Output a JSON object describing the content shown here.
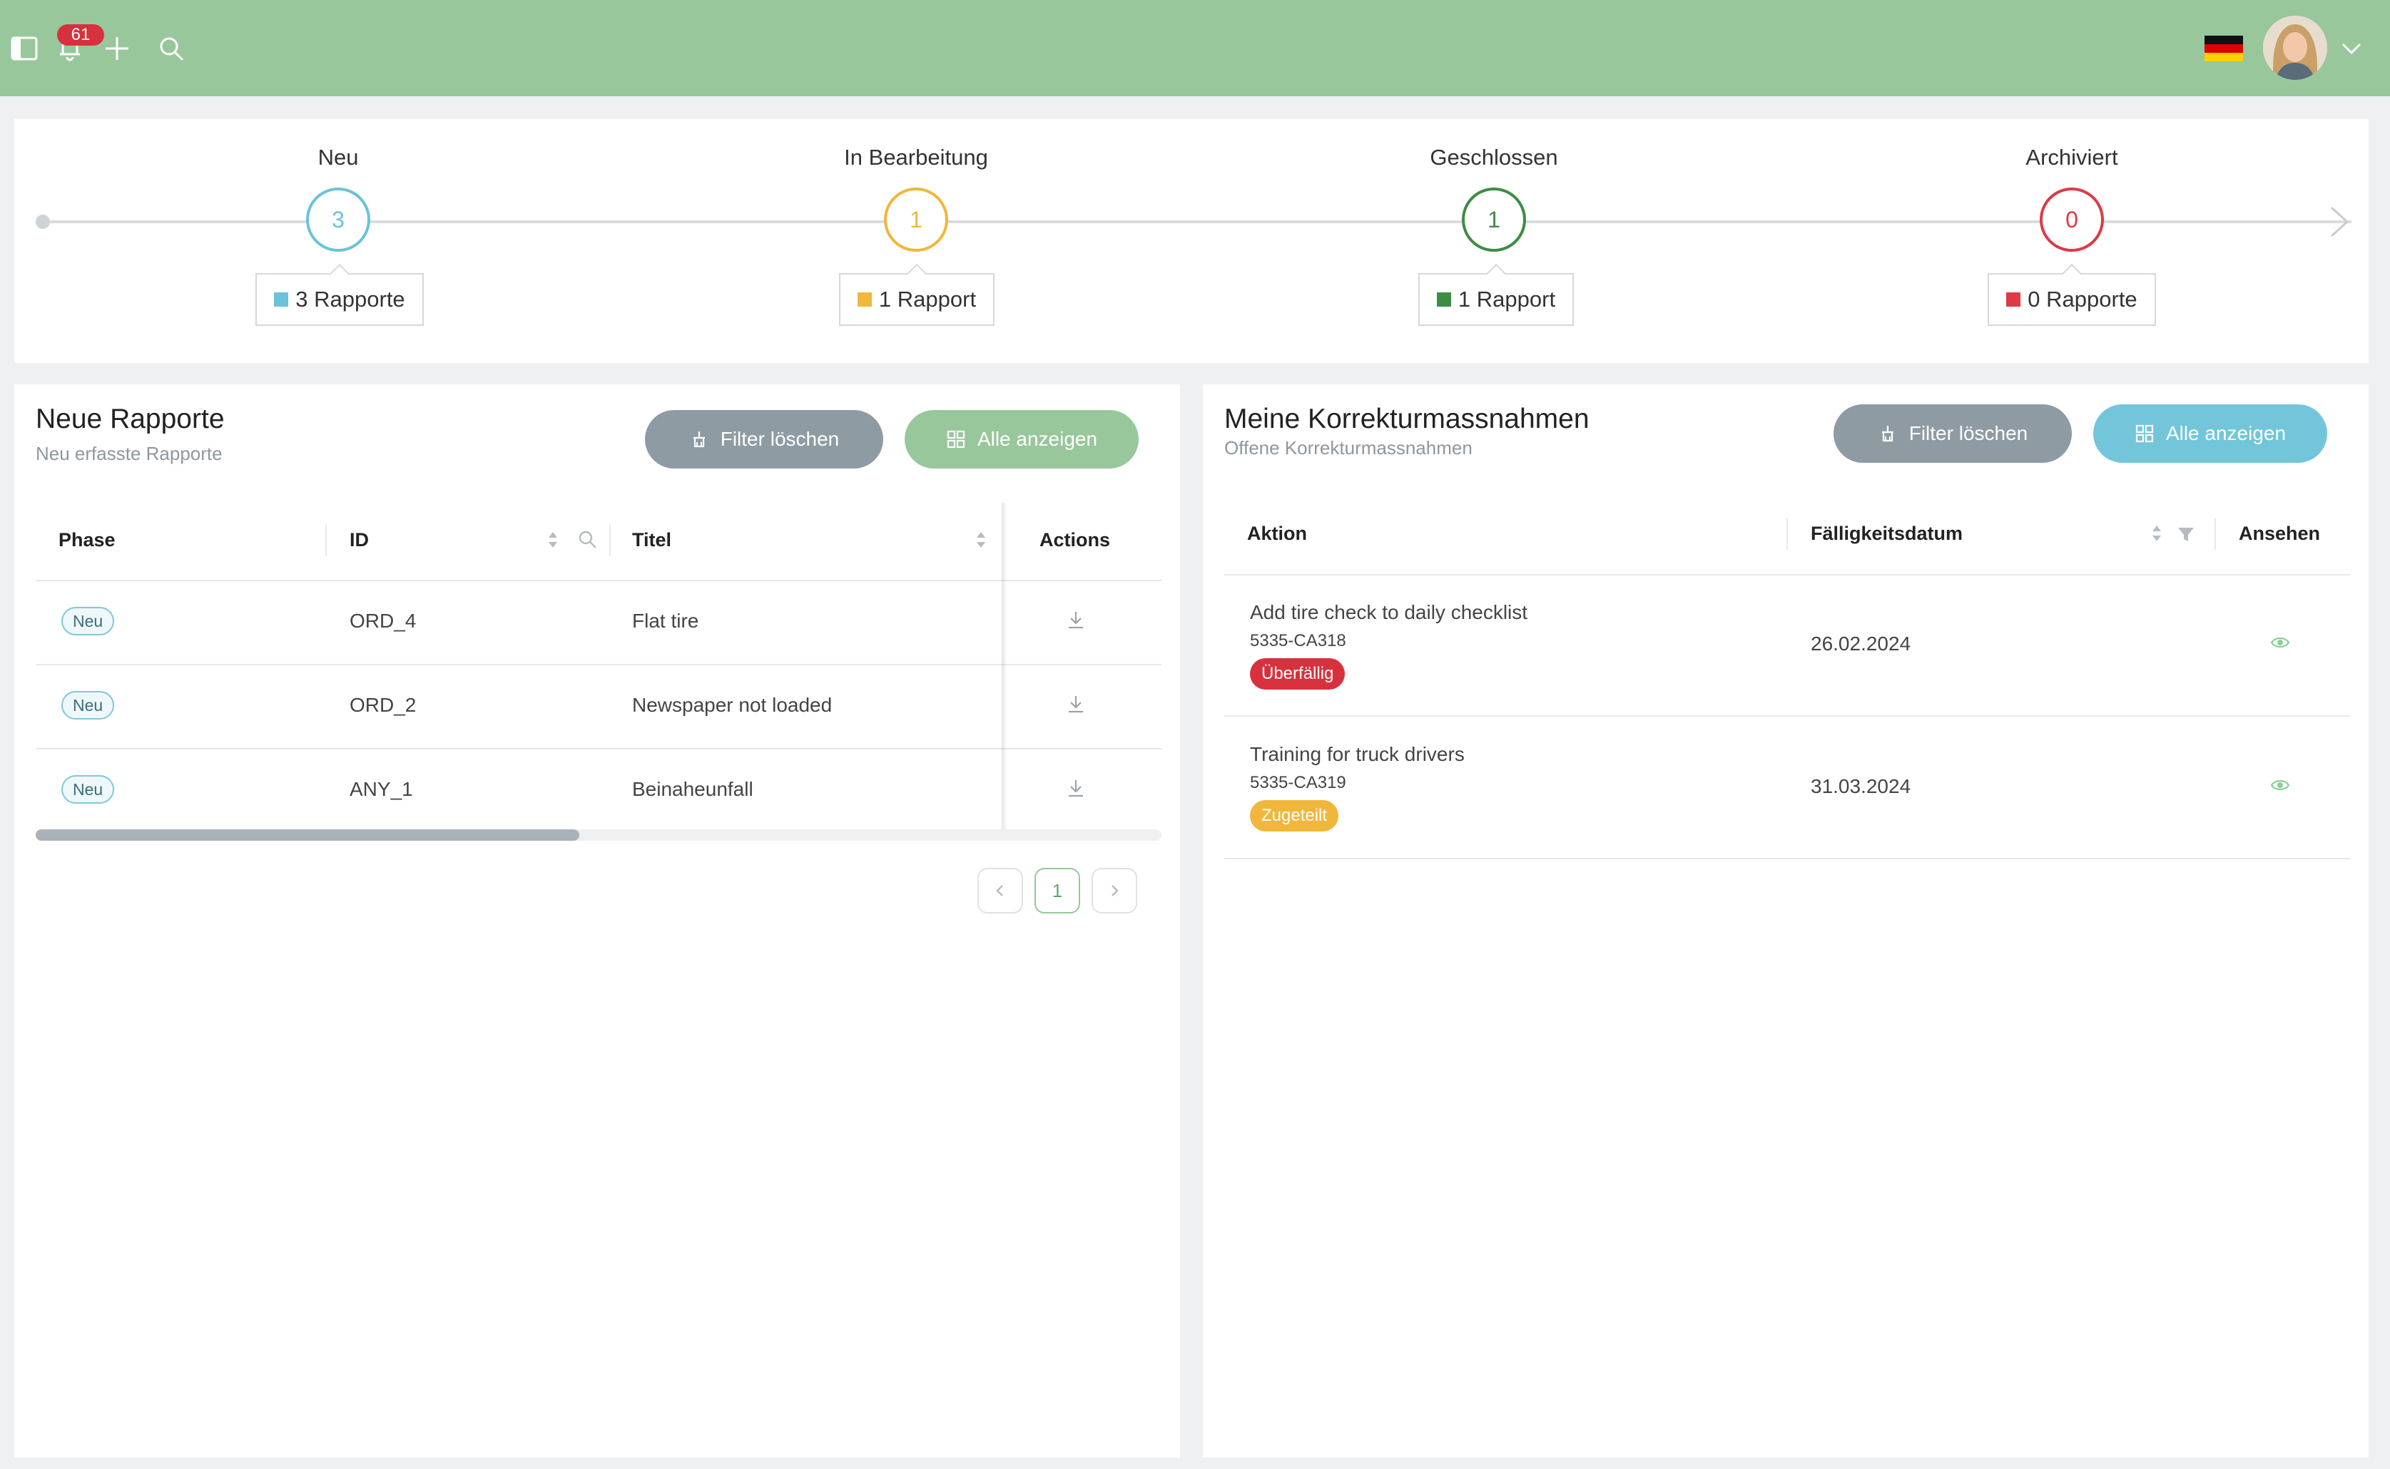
{
  "topbar": {
    "notification_count": "61",
    "language_flag": "flag-germany",
    "colors": {
      "bar": "#98c79c",
      "badge": "#d8313e"
    }
  },
  "phases": [
    {
      "label": "Neu",
      "count": "3",
      "summary": "3 Rapporte",
      "color": "#6ac3d9"
    },
    {
      "label": "In Bearbeitung",
      "count": "1",
      "summary": "1 Rapport",
      "color": "#f0b73c"
    },
    {
      "label": "Geschlossen",
      "count": "1",
      "summary": "1 Rapport",
      "color": "#3d8c45"
    },
    {
      "label": "Archiviert",
      "count": "0",
      "summary": "0 Rapporte",
      "color": "#dd3a46"
    }
  ],
  "reports": {
    "title": "Neue Rapporte",
    "subtitle": "Neu erfasste Rapporte",
    "filter_clear_label": "Filter löschen",
    "show_all_label": "Alle anzeigen",
    "columns": [
      "Phase",
      "ID",
      "Titel",
      "Actions"
    ],
    "rows": [
      {
        "phase": "Neu",
        "id": "ORD_4",
        "title": "Flat tire"
      },
      {
        "phase": "Neu",
        "id": "ORD_2",
        "title": "Newspaper not loaded"
      },
      {
        "phase": "Neu",
        "id": "ANY_1",
        "title": "Beinaheunfall"
      }
    ],
    "pagination": {
      "current_page": "1"
    },
    "colors": {
      "filter_button": "#8f9ba3",
      "show_all_button": "#98c79c"
    }
  },
  "actions": {
    "title": "Meine Korrekturmassnahmen",
    "subtitle": "Offene Korrekturmassnahmen",
    "filter_clear_label": "Filter löschen",
    "show_all_label": "Alle anzeigen",
    "columns": [
      "Aktion",
      "Fälligkeitsdatum",
      "Ansehen"
    ],
    "rows": [
      {
        "action": "Add tire check to daily checklist",
        "code": "5335-CA318",
        "status": "Überfällig",
        "status_color": "#d8313e",
        "due": "26.02.2024"
      },
      {
        "action": "Training for truck drivers",
        "code": "5335-CA319",
        "status": "Zugeteilt",
        "status_color": "#f0b73c",
        "due": "31.03.2024"
      }
    ],
    "colors": {
      "filter_button": "#8f9ba3",
      "show_all_button": "#73c6da"
    }
  }
}
